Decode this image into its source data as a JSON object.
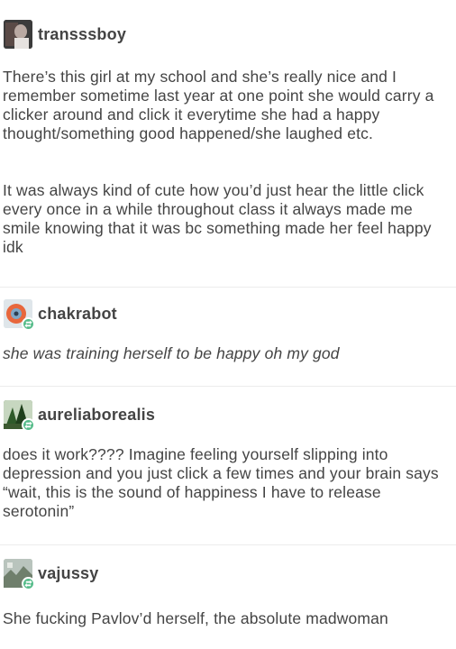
{
  "posts": [
    {
      "username": "transssboy",
      "paragraphs": [
        "There’s this girl at my school and she’s really nice and I remember sometime last year at one point she would carry a clicker around and click it everytime she had a happy thought/something good happened/she laughed etc.",
        "It was always kind of cute how you’d just hear the little click every once in a while throughout class it always made me smile knowing that it was bc something made her feel happy idk"
      ]
    },
    {
      "username": "chakrabot",
      "paragraphs": [
        "she was training herself to be happy oh my god"
      ]
    },
    {
      "username": "aureliaborealis",
      "paragraphs": [
        "does it work???? Imagine feeling yourself slipping into depression and you just click a few times and your brain says “wait, this is the sound of happiness I have to release serotonin”"
      ]
    },
    {
      "username": "vajussy",
      "paragraphs": [
        "She fucking Pavlov’d herself, the absolute madwoman"
      ]
    }
  ],
  "colors": {
    "text": "#444444",
    "reblog_badge": "#56bc8a",
    "divider": "#ececec"
  }
}
